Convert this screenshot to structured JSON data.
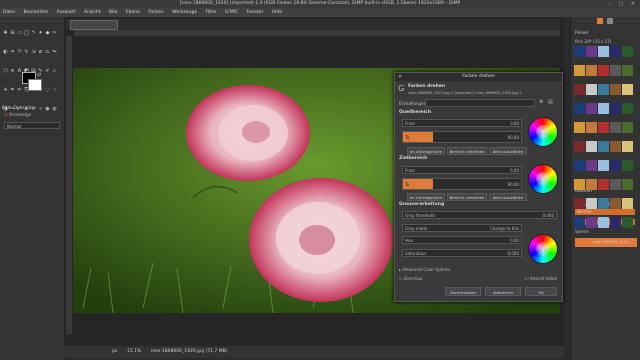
{
  "window": {
    "title": "[rose-1868600_1920] (imported)-1.0 (RGB Farben 16-Bit-Gamma-Ganzzahl, GIMP built-in sRGB, 1 Ebene) 1920x1080 – GIMP"
  },
  "menu": [
    "Datei",
    "Bearbeiten",
    "Auswahl",
    "Ansicht",
    "Bild",
    "Ebene",
    "Farben",
    "Werkzeuge",
    "Filter",
    "G'MIC",
    "Fenster",
    "Hilfe"
  ],
  "tool_options": {
    "title": "Bild: Operation",
    "subtitle": "Voranzeige",
    "mode": "Normal"
  },
  "image_tab": {
    "filename": "rose-1868600_1920.jpg"
  },
  "status": {
    "unit": "px",
    "zoom": "15.1%",
    "info": "rose-1868600_1920.jpg (71,7 MB)"
  },
  "right_panel": {
    "header": "Pinsel",
    "brush_name": "Pins 2H* (15 x 17)",
    "layers_tab": "Ebenen",
    "mode_label": "Modus",
    "mode_value": "Normal",
    "opacity_label": "Deckkraft",
    "opacity_value": "100,0",
    "lock_label": "Sperre:",
    "layer_name": "rose-1868600_1920..."
  },
  "dialog": {
    "window_title": "Farben drehen",
    "heading": "Farben drehen",
    "subheading": "rose-1868600_1920.jpg-1 (Imported) / rose-1868600_1920.jpg-1",
    "presets_label": "Einstellungen",
    "source": {
      "title": "Quellbereich",
      "from_label": "From",
      "from_value": "0,00",
      "to_label": "To",
      "to_value": "90,00",
      "btn_cw": "Im Uhrzeigersinn",
      "btn_invert": "Bereich umkehren",
      "btn_all": "Alles auswählen"
    },
    "target": {
      "title": "Zielbereich",
      "from_label": "From",
      "from_value": "0,00",
      "to_label": "To",
      "to_value": "90,00",
      "btn_cw": "Im Uhrzeigersinn",
      "btn_invert": "Bereich umkehren",
      "btn_all": "Alles auswählen"
    },
    "gray": {
      "title": "Grauverarbeitung",
      "threshold_label": "Gray threshold",
      "threshold_value": "0,000",
      "mode_label": "Gray mode",
      "mode_value": "Change to this",
      "hue_label": "Hue",
      "hue_value": "0,00",
      "sat_label": "Saturation",
      "sat_value": "0,000"
    },
    "advanced": "Advanced Color Options",
    "preview_label": "Vorschau",
    "split_label": "Ansicht teilen",
    "reset_btn": "Zurücksetzen",
    "cancel_btn": "Abbrechen",
    "ok_btn": "OK"
  },
  "colors": {
    "accent": "#e07b3b",
    "panel": "#3a3a3a",
    "dark": "#2b2b2b"
  }
}
